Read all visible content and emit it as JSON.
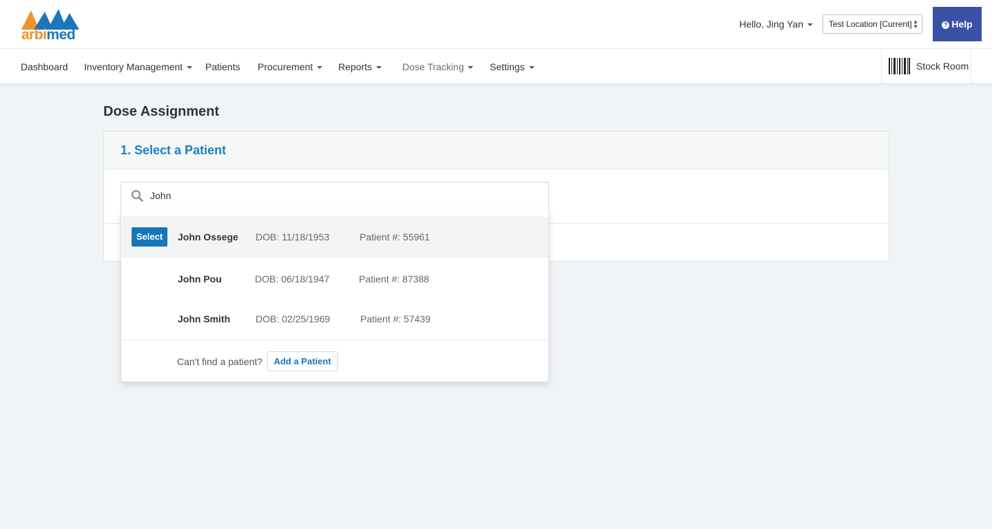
{
  "brand": {
    "logo_part1": "arbi",
    "logo_part2": "med",
    "orange": "#f0922e",
    "blue": "#1b77bb"
  },
  "header": {
    "greeting": "Hello, Jing Yan",
    "location_select": "Test Location [Current]",
    "help_label": "Help"
  },
  "nav": {
    "items": [
      {
        "label": "Dashboard"
      },
      {
        "label": "Inventory Management"
      },
      {
        "label": "Patients"
      },
      {
        "label": "Procurement"
      },
      {
        "label": "Reports"
      },
      {
        "label": "Dose Tracking"
      },
      {
        "label": "Settings"
      }
    ],
    "stock_room": "Stock Room"
  },
  "main": {
    "title": "Dose Assignment",
    "step_title": "1. Select a Patient",
    "search_value": "John"
  },
  "results": [
    {
      "name": "John Ossege",
      "dob": "DOB: 11/18/1953",
      "patient_no": "Patient #: 55961",
      "select_label": "Select"
    },
    {
      "name": "John Pou",
      "dob": "DOB: 06/18/1947",
      "patient_no": "Patient #: 87388"
    },
    {
      "name": "John Smith",
      "dob": "DOB: 02/25/1969",
      "patient_no": "Patient #: 57439"
    }
  ],
  "footer": {
    "cant_find": "Can't find a patient?",
    "add_patient": "Add a Patient"
  }
}
